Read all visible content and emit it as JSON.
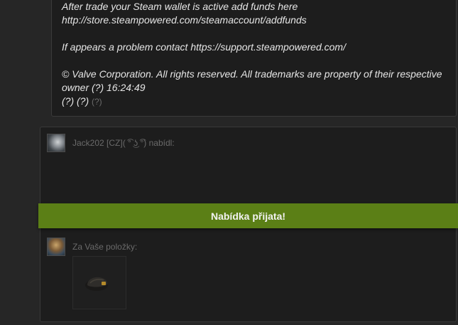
{
  "message": {
    "line1": "After trade your Steam wallet is active add funds here",
    "line2": "http://store.steampowered.com/steamaccount/addfunds",
    "line3": "If appears a problem contact https://support.steampowered.com/",
    "line4": "© Valve Corporation. All rights reserved. All trademarks are property of their respective",
    "line5": "owner (?) 16:24:49",
    "line6": "(?) (?)",
    "line6_small": "(?)"
  },
  "trade": {
    "partner_header": "Jack202 [CZ]( ͡° ͜ʖ ͡°) nabídl:",
    "your_header": "Za Vaše položky:",
    "banner_text": "Nabídka přijata!"
  },
  "colors": {
    "banner": "#5b7f16",
    "panel": "#1d1d1d",
    "background": "#262626"
  },
  "icons": {
    "item": "tf2-hat-icon"
  }
}
